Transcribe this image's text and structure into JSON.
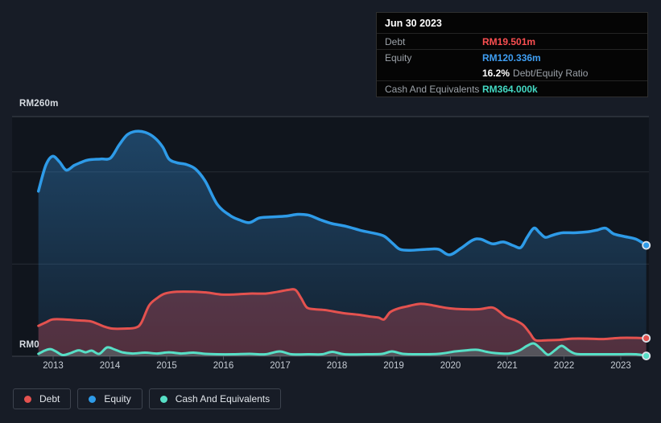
{
  "page": {
    "background": "#171c26",
    "plot_background": "#10151d"
  },
  "y_axis": {
    "top_label": "RM260m",
    "bottom_label": "RM0"
  },
  "x_axis": {
    "years": [
      "2013",
      "2014",
      "2015",
      "2016",
      "2017",
      "2018",
      "2019",
      "2020",
      "2021",
      "2022",
      "2023"
    ]
  },
  "tooltip": {
    "date": "Jun 30 2023",
    "rows": [
      {
        "name": "debt",
        "label": "Debt",
        "value": "RM19.501m",
        "value_color": "#fb4f51"
      },
      {
        "name": "equity",
        "label": "Equity",
        "value": "RM120.336m",
        "value_color": "#3f9ef2",
        "sub": {
          "pct": "16.2%",
          "text": "Debt/Equity Ratio"
        }
      },
      {
        "name": "cash-and-equivalents",
        "label": "Cash And Equivalents",
        "value": "RM364.000k",
        "value_color": "#43d9c3"
      }
    ]
  },
  "legend": {
    "items": [
      {
        "name": "debt",
        "label": "Debt",
        "color": "#e4524f"
      },
      {
        "name": "equity",
        "label": "Equity",
        "color": "#2e9be8"
      },
      {
        "name": "cash-and-equivalents",
        "label": "Cash And Equivalents",
        "color": "#57dfc6"
      }
    ]
  },
  "colors": {
    "grid_major": "#3e444d",
    "grid_minor": "#262c35",
    "tick": "#4a505a",
    "marker_ring": "#dde3ea"
  },
  "chart_data": {
    "type": "area",
    "title": "Debt Equity and Cash history",
    "x_unit": "year (decimal)",
    "y_unit": "RM millions",
    "xlim": [
      2012.74,
      2023.45
    ],
    "ylim": [
      0,
      260
    ],
    "y_gridlines": [
      260,
      200,
      100,
      0
    ],
    "x_ticks": [
      2013,
      2014,
      2015,
      2016,
      2017,
      2018,
      2019,
      2020,
      2021,
      2022,
      2023
    ],
    "legend_position": "bottom-left",
    "series": [
      {
        "name": "Equity",
        "color": "#2e9be8",
        "points": [
          [
            2012.74,
            179
          ],
          [
            2012.87,
            207
          ],
          [
            2012.99,
            217
          ],
          [
            2013.11,
            211
          ],
          [
            2013.23,
            202
          ],
          [
            2013.37,
            207
          ],
          [
            2013.48,
            210
          ],
          [
            2013.62,
            213
          ],
          [
            2013.84,
            214
          ],
          [
            2014.01,
            215
          ],
          [
            2014.16,
            229
          ],
          [
            2014.3,
            240
          ],
          [
            2014.45,
            244
          ],
          [
            2014.62,
            243
          ],
          [
            2014.79,
            237
          ],
          [
            2014.93,
            227
          ],
          [
            2015.04,
            214
          ],
          [
            2015.18,
            210
          ],
          [
            2015.35,
            208
          ],
          [
            2015.51,
            203
          ],
          [
            2015.68,
            190
          ],
          [
            2015.89,
            165
          ],
          [
            2016.11,
            153
          ],
          [
            2016.28,
            148
          ],
          [
            2016.46,
            145
          ],
          [
            2016.63,
            150
          ],
          [
            2016.82,
            151
          ],
          [
            2017.1,
            152
          ],
          [
            2017.31,
            154
          ],
          [
            2017.5,
            153
          ],
          [
            2017.71,
            148
          ],
          [
            2017.91,
            144
          ],
          [
            2018.16,
            141
          ],
          [
            2018.45,
            136
          ],
          [
            2018.69,
            133
          ],
          [
            2018.84,
            130
          ],
          [
            2018.99,
            122
          ],
          [
            2019.11,
            116
          ],
          [
            2019.3,
            115
          ],
          [
            2019.58,
            116
          ],
          [
            2019.79,
            116
          ],
          [
            2019.98,
            110
          ],
          [
            2020.18,
            117
          ],
          [
            2020.39,
            126
          ],
          [
            2020.53,
            127
          ],
          [
            2020.74,
            122
          ],
          [
            2020.93,
            124
          ],
          [
            2021.11,
            120
          ],
          [
            2021.24,
            118
          ],
          [
            2021.35,
            129
          ],
          [
            2021.47,
            139
          ],
          [
            2021.57,
            134
          ],
          [
            2021.67,
            129
          ],
          [
            2021.78,
            131
          ],
          [
            2021.89,
            133
          ],
          [
            2021.99,
            134
          ],
          [
            2022.21,
            134
          ],
          [
            2022.42,
            135
          ],
          [
            2022.59,
            137
          ],
          [
            2022.73,
            139
          ],
          [
            2022.87,
            133
          ],
          [
            2023.06,
            130
          ],
          [
            2023.27,
            127
          ],
          [
            2023.45,
            120.336
          ]
        ]
      },
      {
        "name": "Debt",
        "color": "#e4524f",
        "points": [
          [
            2012.74,
            33
          ],
          [
            2012.88,
            37
          ],
          [
            2012.99,
            40
          ],
          [
            2013.2,
            40
          ],
          [
            2013.41,
            39
          ],
          [
            2013.65,
            38
          ],
          [
            2013.79,
            35
          ],
          [
            2013.91,
            32
          ],
          [
            2014.05,
            30
          ],
          [
            2014.26,
            30
          ],
          [
            2014.45,
            31
          ],
          [
            2014.55,
            36
          ],
          [
            2014.69,
            55
          ],
          [
            2014.83,
            63
          ],
          [
            2014.97,
            68
          ],
          [
            2015.18,
            70
          ],
          [
            2015.47,
            70
          ],
          [
            2015.72,
            69
          ],
          [
            2015.96,
            67
          ],
          [
            2016.18,
            67
          ],
          [
            2016.46,
            68
          ],
          [
            2016.74,
            68
          ],
          [
            2016.96,
            70
          ],
          [
            2017.14,
            72
          ],
          [
            2017.27,
            72
          ],
          [
            2017.37,
            63
          ],
          [
            2017.47,
            53
          ],
          [
            2017.6,
            51
          ],
          [
            2017.81,
            50
          ],
          [
            2018.09,
            47
          ],
          [
            2018.38,
            45
          ],
          [
            2018.59,
            43
          ],
          [
            2018.73,
            42
          ],
          [
            2018.83,
            40
          ],
          [
            2018.94,
            48
          ],
          [
            2019.09,
            52
          ],
          [
            2019.23,
            54
          ],
          [
            2019.37,
            56
          ],
          [
            2019.48,
            57
          ],
          [
            2019.62,
            56
          ],
          [
            2019.79,
            54
          ],
          [
            2019.98,
            52
          ],
          [
            2020.22,
            51
          ],
          [
            2020.5,
            51
          ],
          [
            2020.72,
            53
          ],
          [
            2020.83,
            50
          ],
          [
            2020.97,
            43
          ],
          [
            2021.14,
            39
          ],
          [
            2021.28,
            34
          ],
          [
            2021.4,
            25
          ],
          [
            2021.5,
            17.4
          ],
          [
            2021.71,
            17.4
          ],
          [
            2021.92,
            17.8
          ],
          [
            2022.14,
            19.1
          ],
          [
            2022.42,
            19.1
          ],
          [
            2022.7,
            18.7
          ],
          [
            2022.99,
            20
          ],
          [
            2023.27,
            20
          ],
          [
            2023.45,
            19.501
          ]
        ]
      },
      {
        "name": "Cash And Equivalents",
        "color": "#57dfc6",
        "points": [
          [
            2012.74,
            2.6
          ],
          [
            2012.85,
            6.1
          ],
          [
            2012.95,
            7.8
          ],
          [
            2013.05,
            5.2
          ],
          [
            2013.17,
            1.3
          ],
          [
            2013.31,
            3.5
          ],
          [
            2013.45,
            6.5
          ],
          [
            2013.57,
            4.3
          ],
          [
            2013.68,
            6.1
          ],
          [
            2013.81,
            2.6
          ],
          [
            2013.95,
            9.6
          ],
          [
            2014.08,
            7.4
          ],
          [
            2014.22,
            4.3
          ],
          [
            2014.4,
            3
          ],
          [
            2014.62,
            3.9
          ],
          [
            2014.83,
            3
          ],
          [
            2015.04,
            4.3
          ],
          [
            2015.26,
            3
          ],
          [
            2015.47,
            3.9
          ],
          [
            2015.68,
            2.6
          ],
          [
            2015.89,
            2.2
          ],
          [
            2016.18,
            2.2
          ],
          [
            2016.46,
            2.6
          ],
          [
            2016.74,
            2.2
          ],
          [
            2016.99,
            5.2
          ],
          [
            2017.2,
            2.2
          ],
          [
            2017.52,
            2.2
          ],
          [
            2017.74,
            2.2
          ],
          [
            2017.92,
            4.8
          ],
          [
            2018.13,
            2.2
          ],
          [
            2018.52,
            2.2
          ],
          [
            2018.8,
            2.6
          ],
          [
            2018.97,
            5.2
          ],
          [
            2019.16,
            2.6
          ],
          [
            2019.44,
            2.2
          ],
          [
            2019.79,
            2.6
          ],
          [
            2020.08,
            5.2
          ],
          [
            2020.29,
            6.5
          ],
          [
            2020.47,
            7
          ],
          [
            2020.64,
            4.8
          ],
          [
            2020.78,
            3.5
          ],
          [
            2021.03,
            3
          ],
          [
            2021.21,
            6.1
          ],
          [
            2021.35,
            11.3
          ],
          [
            2021.47,
            13.9
          ],
          [
            2021.6,
            7.8
          ],
          [
            2021.72,
            1.7
          ],
          [
            2021.85,
            7
          ],
          [
            2021.96,
            11.3
          ],
          [
            2022.09,
            6.1
          ],
          [
            2022.21,
            2.6
          ],
          [
            2022.42,
            2.2
          ],
          [
            2022.7,
            2.2
          ],
          [
            2022.99,
            2.2
          ],
          [
            2023.27,
            2.2
          ],
          [
            2023.45,
            0.364
          ]
        ]
      }
    ]
  }
}
